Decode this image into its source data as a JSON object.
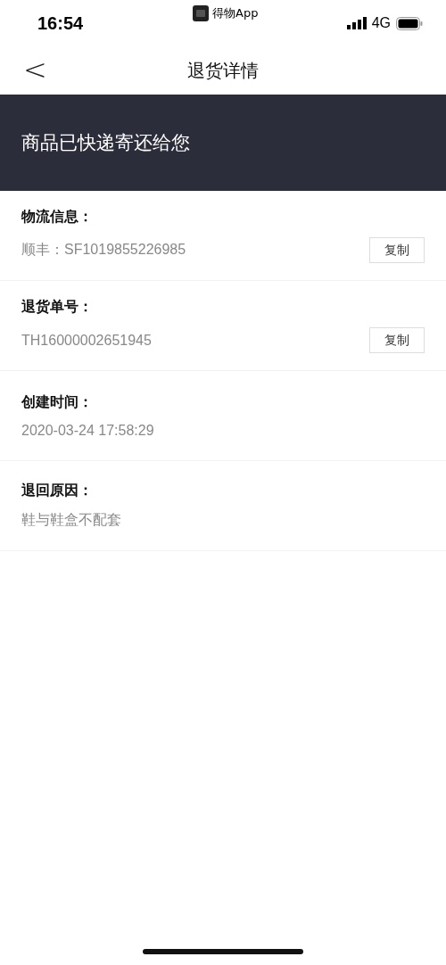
{
  "status_bar": {
    "time": "16:54",
    "app_name": "得物App",
    "network": "4G"
  },
  "nav": {
    "back": "<",
    "title": "退货详情"
  },
  "banner": {
    "text": "商品已快递寄还给您"
  },
  "sections": [
    {
      "label": "物流信息：",
      "value": "顺丰：SF1019855226985",
      "button": "复制"
    },
    {
      "label": "退货单号：",
      "value": "TH16000002651945",
      "button": "复制"
    },
    {
      "label": "创建时间：",
      "value": "2020-03-24 17:58:29"
    },
    {
      "label": "退回原因：",
      "value": "鞋与鞋盒不配套"
    }
  ]
}
